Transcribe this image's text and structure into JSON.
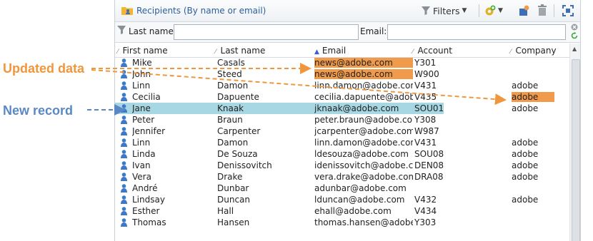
{
  "annotations": {
    "updated": "Updated data",
    "new": "New record"
  },
  "toolbar": {
    "title": "Recipients (By name or email)",
    "filters_label": "Filters",
    "icons": [
      "folder-people-icon",
      "filter-funnel-icon",
      "gear-add-icon",
      "new-recipient-icon",
      "trash-icon",
      "fit-window-icon"
    ]
  },
  "filter": {
    "last_name_label": "Last name:",
    "last_name_value": "",
    "email_label": "Email:",
    "email_value": ""
  },
  "grid": {
    "columns": [
      "First name",
      "Last name",
      "Email",
      "Account",
      "Company"
    ],
    "sorted_column": "Email",
    "rows": [
      {
        "first": "Mike",
        "last": "Casals",
        "email": "news@adobe.com",
        "account": "Y301",
        "company": ""
      },
      {
        "first": "John",
        "last": "Steed",
        "email": "news@adobe.com",
        "account": "W900",
        "company": ""
      },
      {
        "first": "Linn",
        "last": "Damon",
        "email": "linn.damon@adobe.com",
        "account": "V431",
        "company": "adobe"
      },
      {
        "first": "Cecilia",
        "last": "Dapuente",
        "email": "cecilia.dapuente@adobe.com",
        "account": "V435",
        "company": "adobe"
      },
      {
        "first": "Jane",
        "last": "Knaak",
        "email": "jknaak@adobe.com",
        "account": "SOU01",
        "company": "adobe"
      },
      {
        "first": "Peter",
        "last": "Braun",
        "email": "peter.braun@adobe.com",
        "account": "Y308",
        "company": ""
      },
      {
        "first": "Jennifer",
        "last": "Carpenter",
        "email": "jcarpenter@adobe.com",
        "account": "W987",
        "company": ""
      },
      {
        "first": "Linn",
        "last": "Damon",
        "email": "linn.damon@adobe.com",
        "account": "V431",
        "company": "adobe"
      },
      {
        "first": "Linda",
        "last": "De Souza",
        "email": "ldesouza@adobe.com",
        "account": "SOU08",
        "company": "adobe"
      },
      {
        "first": "Ivan",
        "last": "Denissovitch",
        "email": "idenissovitch@adobe.com",
        "account": "DEN08",
        "company": "adobe"
      },
      {
        "first": "Vera",
        "last": "Drake",
        "email": "vera.drake@adobe.com",
        "account": "DRA08",
        "company": "adobe"
      },
      {
        "first": "André",
        "last": "Dunbar",
        "email": "adunbar@adobe.com",
        "account": "",
        "company": ""
      },
      {
        "first": "Lindsay",
        "last": "Duncan",
        "email": "lduncan@adobe.com",
        "account": "V432",
        "company": "adobe"
      },
      {
        "first": "Esther",
        "last": "Hall",
        "email": "ehall@adobe.com",
        "account": "V434",
        "company": ""
      },
      {
        "first": "Thomas",
        "last": "Hansen",
        "email": "thomas.hansen@adobe.com",
        "account": "Y303",
        "company": ""
      }
    ]
  },
  "colors": {
    "annotation_orange": "#f0963c",
    "annotation_blue": "#5b88c4",
    "highlight_orange": "#f09a4c",
    "new_row": "#a7d7e3",
    "title_blue": "#2c5f9c"
  }
}
